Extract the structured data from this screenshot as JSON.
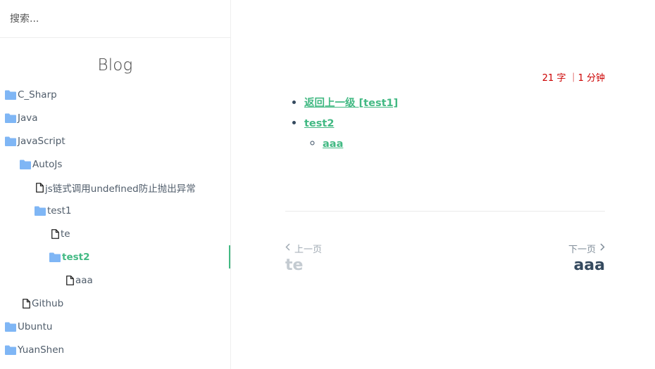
{
  "search": {
    "placeholder": "搜索..."
  },
  "sidebar": {
    "app_name": "Blog",
    "items": [
      {
        "label": "C_Sharp",
        "type": "folder"
      },
      {
        "label": "Java",
        "type": "folder"
      },
      {
        "label": "JavaScript",
        "type": "folder"
      },
      {
        "label": "AutoJs",
        "type": "folder"
      },
      {
        "label": "js链式调用undefined防止抛出异常",
        "type": "file"
      },
      {
        "label": "test1",
        "type": "folder"
      },
      {
        "label": "te",
        "type": "file"
      },
      {
        "label": "test2",
        "type": "folder",
        "active": true
      },
      {
        "label": "aaa",
        "type": "file"
      },
      {
        "label": "Github",
        "type": "file"
      },
      {
        "label": "Ubuntu",
        "type": "folder"
      },
      {
        "label": "YuanShen",
        "type": "folder"
      }
    ]
  },
  "main": {
    "word_count": "21 字 ｜1 分钟",
    "toc": {
      "back_link": "返回上一级 [test1]",
      "current": "test2",
      "child": "aaa"
    },
    "pager": {
      "prev_label": "上一页",
      "prev_title": "te",
      "next_label": "下一页",
      "next_title": "aaa"
    }
  },
  "colors": {
    "accent": "#42b983",
    "folder_icon": "#7fb6f5",
    "word_count": "#cc0000",
    "text": "#34495e"
  }
}
